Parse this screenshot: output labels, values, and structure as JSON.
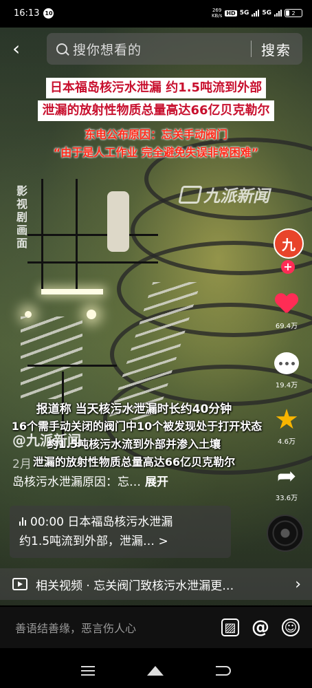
{
  "status_bar": {
    "time": "16:13",
    "notification_count": "10",
    "net_speed": "269\nKB/s",
    "network_labels": [
      "HD",
      "5G",
      "5G"
    ],
    "battery": "2"
  },
  "search": {
    "placeholder": "搜你想看的",
    "button_label": "搜索"
  },
  "headline": {
    "line1": "日本福岛核污水泄漏 约1.5吨流到外部",
    "line2": "泄漏的放射性物质总量高达66亿贝克勒尔",
    "line3": "东电公布原因：忘关手动阀门",
    "line4": "“由于是人工作业 完全避免失误非常困难”"
  },
  "watermarks": {
    "drama_note": "影视剧画面",
    "brand": "九派新闻"
  },
  "actions": {
    "avatar_initial": "九",
    "follow": "+",
    "likes": "69.4万",
    "comments": "19.4万",
    "favorites": "4.6万",
    "shares": "33.6万"
  },
  "lower_caption": {
    "line1": "报道称 当天核污水泄漏时长约40分钟",
    "line2": "16个需手动关闭的阀门中10个被发现处于打开状态",
    "line3": "约1.5吨核污水流到外部并渗入土壤",
    "line4": "泄漏的放射性物质总量高达66亿贝克勒尔"
  },
  "post": {
    "author": "@九派新闻",
    "desc_line1": "2月",
    "desc_line2": "岛核污水泄漏原因：忘…",
    "expand": "展开"
  },
  "music": {
    "line1": "00:00  日本福岛核污水泄漏",
    "line2": "约1.5吨流到外部，泄漏…",
    "chevron": ">"
  },
  "related": {
    "text": "相关视频 · 忘关阀门致核污水泄漏更…",
    "chevron": "›"
  },
  "comment_bar": {
    "placeholder": "善语结善缘，恶言伤人心"
  },
  "colors": {
    "caption_red": "#c8102e",
    "like_pink": "#ff2c55",
    "favorite_gold": "#f7b500",
    "highlight_yellow": "#ffd84a"
  }
}
